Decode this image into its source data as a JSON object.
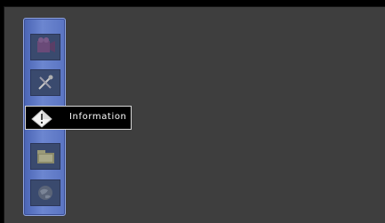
{
  "menu": {
    "items": [
      {
        "icon": "video-icon",
        "label": null,
        "selected": false
      },
      {
        "icon": "tools-icon",
        "label": null,
        "selected": false
      },
      {
        "icon": "information-icon",
        "label": "Information",
        "selected": true
      },
      {
        "icon": "folder-icon",
        "label": null,
        "selected": false
      },
      {
        "icon": "globe-icon",
        "label": null,
        "selected": false
      }
    ]
  },
  "colors": {
    "background": "#3e3e3e",
    "sidebar": "#5a74c2",
    "highlight_border": "#d8d8d8"
  }
}
